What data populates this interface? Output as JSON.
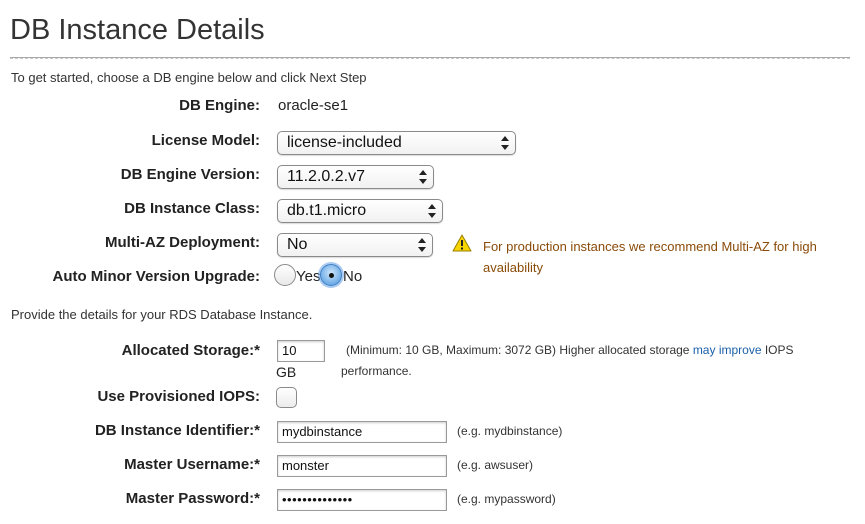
{
  "page": {
    "title": "DB Instance Details",
    "intro": "To get started, choose a DB engine below and click Next Step",
    "section2_intro": "Provide the details for your RDS Database Instance."
  },
  "engine": {
    "label": "DB Engine:",
    "value": "oracle-se1"
  },
  "license_model": {
    "label": "License Model:",
    "value": "license-included"
  },
  "engine_version": {
    "label": "DB Engine Version:",
    "value": "11.2.0.2.v7"
  },
  "instance_class": {
    "label": "DB Instance Class:",
    "value": "db.t1.micro"
  },
  "multi_az": {
    "label": "Multi-AZ Deployment:",
    "value": "No",
    "warning_icon": "warning-triangle-icon",
    "warning_line1": "For production instances we recommend Multi-AZ for high",
    "warning_line2": "availability"
  },
  "auto_minor": {
    "label": "Auto Minor Version Upgrade:",
    "options": [
      {
        "label": "Yes",
        "checked": false
      },
      {
        "label": "No",
        "checked": true
      }
    ]
  },
  "storage": {
    "label": "Allocated Storage:*",
    "value": "10",
    "unit": "GB",
    "hint_prefix": "(Minimum: 10 GB, Maximum: 3072 GB) Higher allocated storage",
    "hint_link": "may improve",
    "hint_suffix": "IOPS",
    "hint_line2": "performance."
  },
  "provisioned_iops": {
    "label": "Use Provisioned IOPS:",
    "checked": false
  },
  "identifier": {
    "label": "DB Instance Identifier:*",
    "value": "mydbinstance",
    "hint": "(e.g. mydbinstance)"
  },
  "username": {
    "label": "Master Username:*",
    "value": "monster",
    "hint": "(e.g. awsuser)"
  },
  "password": {
    "label": "Master Password:*",
    "value": "••••••••••••••",
    "hint": "(e.g. mypassword)"
  }
}
